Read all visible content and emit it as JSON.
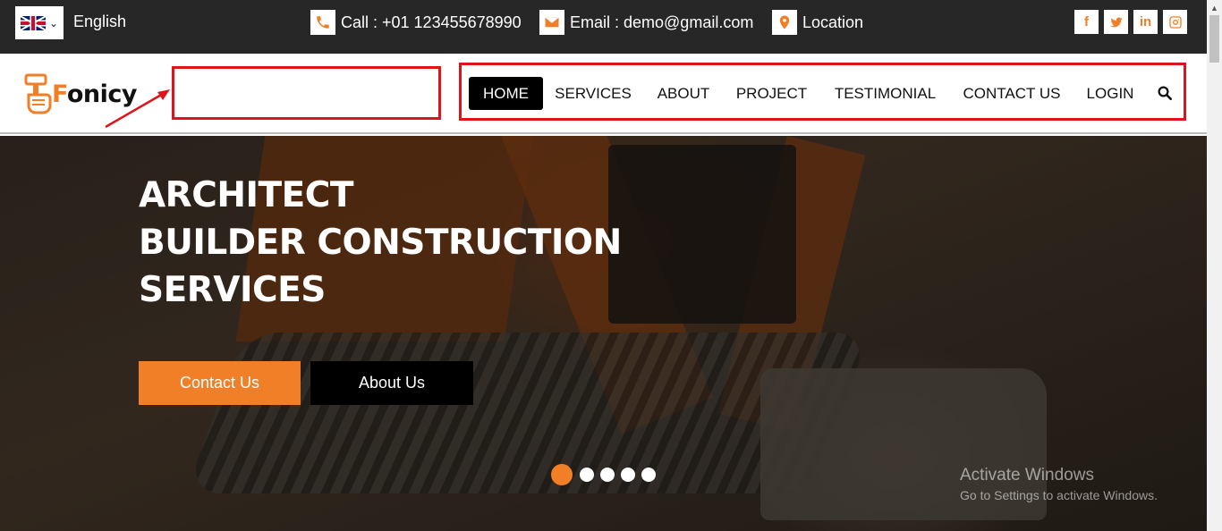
{
  "topbar": {
    "language": "English",
    "flag_icon": "uk-flag-icon",
    "call": "Call : +01 123455678990",
    "email": "Email : demo@gmail.com",
    "location": "Location",
    "social": [
      "facebook-icon",
      "twitter-icon",
      "linkedin-icon",
      "instagram-icon"
    ],
    "social_labels": {
      "facebook": "f",
      "linkedin": "in"
    }
  },
  "header": {
    "logo_text_first": "F",
    "logo_text_rest": "onicy"
  },
  "nav": {
    "items": [
      "HOME",
      "SERVICES",
      "ABOUT",
      "PROJECT",
      "TESTIMONIAL",
      "CONTACT US",
      "LOGIN"
    ],
    "active": "HOME"
  },
  "hero": {
    "title_line1": "ARCHITECT",
    "title_line2": "BUILDER CONSTRUCTION",
    "title_line3": "SERVICES",
    "btn_primary": "Contact Us",
    "btn_secondary": "About Us",
    "slide_count": 5,
    "active_slide": 1
  },
  "watermark": {
    "line1": "Activate Windows",
    "line2": "Go to Settings to activate Windows."
  },
  "colors": {
    "accent": "#f07f27",
    "topbar": "#272727",
    "annotation": "#e0131b"
  }
}
